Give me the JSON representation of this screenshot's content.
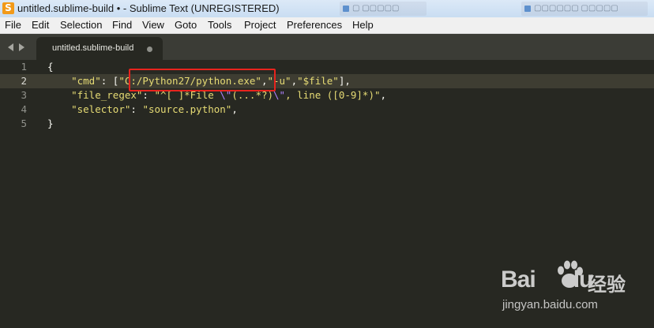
{
  "window": {
    "title": "untitled.sublime-build • - Sublime Text (UNREGISTERED)",
    "app_icon": "sublime-text-icon"
  },
  "menu": [
    "File",
    "Edit",
    "Selection",
    "Find",
    "View",
    "Goto",
    "Tools",
    "Project",
    "Preferences",
    "Help"
  ],
  "tabs": [
    {
      "label": "untitled.sublime-build",
      "dirty_indicator": "●"
    }
  ],
  "editor": {
    "line_numbers": [
      "1",
      "2",
      "3",
      "4",
      "5"
    ],
    "current_line": 2,
    "lines": [
      "{",
      "    \"cmd\": [\"C:/Python27/python.exe\",\"-u\",\"$file\"],",
      "    \"file_regex\": \"^[ ]*File \\\"(...*?)\\\", line ([0-9]*)\",",
      "    \"selector\": \"source.python\",",
      "}"
    ],
    "highlighted_text": "C:/Python27/python.exe"
  },
  "watermark": {
    "brand": "Bai",
    "brand_suffix": "du",
    "cn": "经验",
    "url": "jingyan.baidu.com"
  },
  "colors": {
    "background": "#272822",
    "string": "#e6db74",
    "escape": "#ae81ff",
    "highlight_box": "#e8231d"
  }
}
